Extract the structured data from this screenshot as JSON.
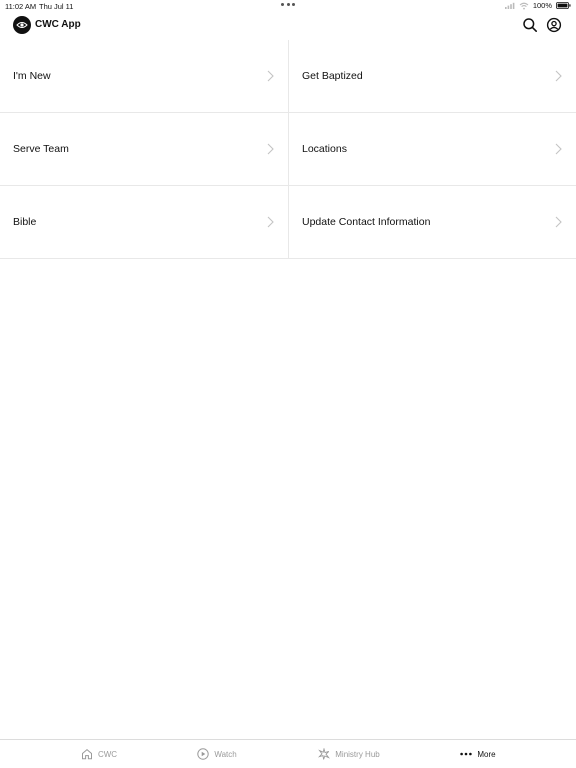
{
  "status_bar": {
    "time": "11:02 AM",
    "date": "Thu Jul 11",
    "battery": "100%"
  },
  "header": {
    "app_name": "CWC App",
    "icons": {
      "search": "search-icon",
      "profile": "profile-icon"
    }
  },
  "menu": {
    "items": [
      {
        "label": "I'm New"
      },
      {
        "label": "Get Baptized"
      },
      {
        "label": "Serve Team"
      },
      {
        "label": "Locations"
      },
      {
        "label": "Bible"
      },
      {
        "label": "Update Contact Information"
      }
    ]
  },
  "tab_bar": {
    "active_color": "#111111",
    "inactive_color": "#9a9a9a",
    "tabs": [
      {
        "label": "CWC",
        "icon": "home-icon",
        "active": false
      },
      {
        "label": "Watch",
        "icon": "play-icon",
        "active": false
      },
      {
        "label": "Ministry Hub",
        "icon": "ministry-hub-icon",
        "active": false
      },
      {
        "label": "More",
        "icon": "more-icon",
        "active": true
      }
    ]
  }
}
